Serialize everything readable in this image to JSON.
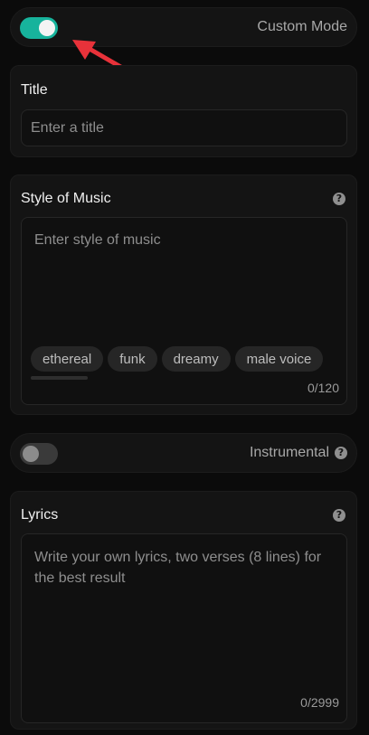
{
  "custom_mode": {
    "label": "Custom Mode",
    "enabled": true
  },
  "title_section": {
    "heading": "Title",
    "placeholder": "Enter a title"
  },
  "style_section": {
    "heading": "Style of Music",
    "placeholder": "Enter style of music",
    "tags": [
      "ethereal",
      "funk",
      "dreamy",
      "male voice"
    ],
    "counter": "0/120"
  },
  "instrumental": {
    "label": "Instrumental",
    "enabled": false
  },
  "lyrics_section": {
    "heading": "Lyrics",
    "placeholder": "Write your own lyrics, two verses (8 lines) for the best result",
    "counter": "0/2999"
  },
  "icons": {
    "help": "?"
  },
  "colors": {
    "accent": "#17b39c",
    "annotation_arrow": "#e8323a"
  }
}
